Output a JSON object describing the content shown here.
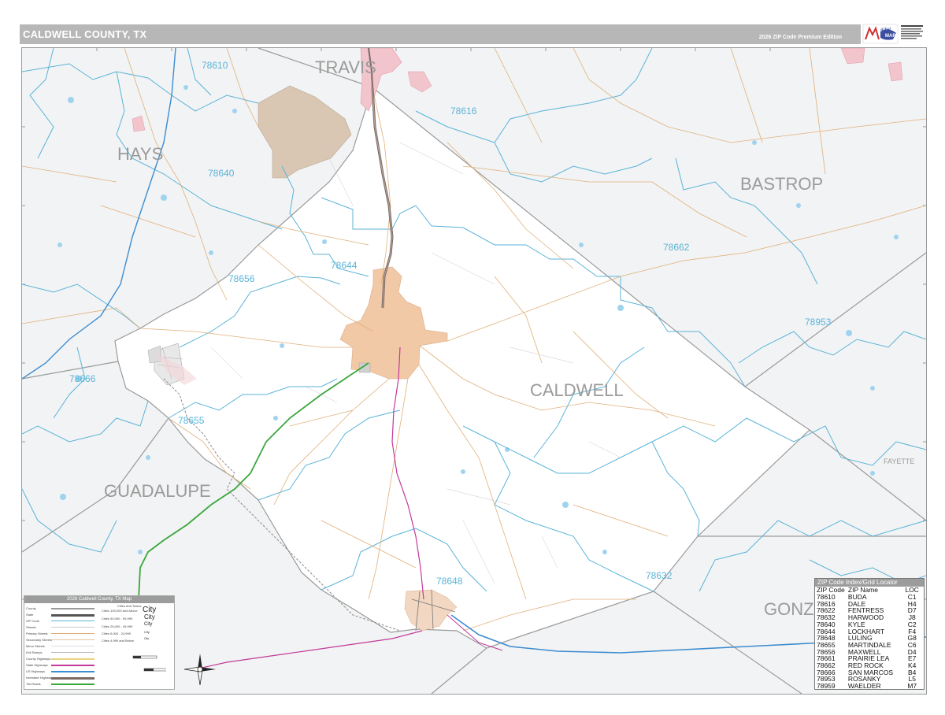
{
  "header": {
    "title": "CALDWELL COUNTY, TX",
    "edition": "2026 ZIP Code Premium Edition"
  },
  "logo": {
    "brand": "Market MAPS",
    "icon": "market-maps-logo"
  },
  "map": {
    "counties": {
      "travis": "TRAVIS",
      "hays": "HAYS",
      "bastrop": "BASTROP",
      "caldwell": "CALDWELL",
      "guadalupe": "GUADALUPE",
      "gonzales": "GONZ",
      "fayette": "FAYETTE"
    },
    "zips": {
      "z78610": "78610",
      "z78616": "78616",
      "z78640": "78640",
      "z78662": "78662",
      "z78644": "78644",
      "z78656": "78656",
      "z78953": "78953",
      "z78666": "78666",
      "z78655": "78655",
      "z78648": "78648",
      "z78632": "78632"
    },
    "colors": {
      "background": "#f2f3f4",
      "county_fill": "#ffffff",
      "zip_boundary": "#5ab4d8",
      "county_boundary": "#9a9a9a",
      "interstate": "#7a6a64",
      "us_highway": "#3c8cd0",
      "toll_road": "#3aa63a",
      "state_highway": "#c23a9b",
      "city_fill": "#f2c9a6",
      "urban_fill": "#d9c7b4",
      "water": "#9fd3ee"
    }
  },
  "legend": {
    "title": "2026 Caldwell County, TX Map",
    "categories_header": "Cities And Towns",
    "rows": [
      "County",
      "State",
      "ZIP Code",
      "Streets",
      "Primary Streets",
      "Secondary Streets",
      "Minor Streets",
      "Exit Ramps",
      "County Highways",
      "State Highways",
      "US Highways",
      "Interstate Highways",
      "Toll Roads"
    ],
    "city_classes": [
      "Cities 100,000 and Above",
      "Cities 50,000 - 99,999",
      "Cities 25,000 - 49,999",
      "Cities 5,000 - 24,999",
      "Cities 4,999 and Below"
    ],
    "city_samples": [
      "City",
      "City",
      "City",
      "City",
      "City"
    ]
  },
  "zip_index": {
    "title": "ZIP Code Index/Grid Locator",
    "headers": [
      "ZIP Code",
      "ZIP Name",
      "LOC"
    ],
    "rows": [
      [
        "78610",
        "BUDA",
        "C1"
      ],
      [
        "78616",
        "DALE",
        "H4"
      ],
      [
        "78622",
        "FENTRESS",
        "D7"
      ],
      [
        "78632",
        "HARWOOD",
        "J8"
      ],
      [
        "78640",
        "KYLE",
        "C2"
      ],
      [
        "78644",
        "LOCKHART",
        "F4"
      ],
      [
        "78648",
        "LULING",
        "G8"
      ],
      [
        "78655",
        "MARTINDALE",
        "C6"
      ],
      [
        "78656",
        "MAXWELL",
        "D4"
      ],
      [
        "78661",
        "PRAIRIE LEA",
        "E7"
      ],
      [
        "78662",
        "RED ROCK",
        "K4"
      ],
      [
        "78666",
        "SAN MARCOS",
        "B4"
      ],
      [
        "78953",
        "ROSANKY",
        "L5"
      ],
      [
        "78959",
        "WAELDER",
        "M7"
      ]
    ]
  }
}
